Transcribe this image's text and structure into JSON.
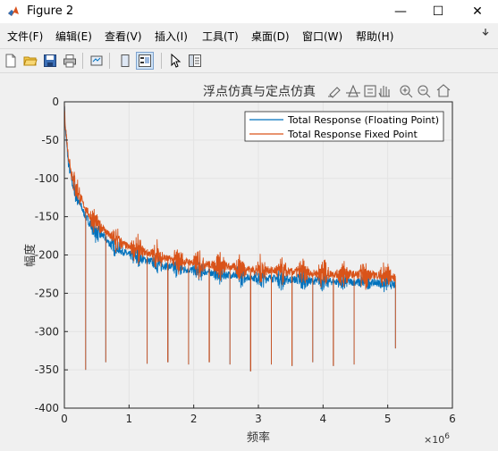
{
  "window": {
    "title": "Figure 2",
    "minimize": "—",
    "maximize": "☐",
    "close": "✕"
  },
  "menu": [
    {
      "label": "文件(F)"
    },
    {
      "label": "编辑(E)"
    },
    {
      "label": "查看(V)"
    },
    {
      "label": "插入(I)"
    },
    {
      "label": "工具(T)"
    },
    {
      "label": "桌面(D)"
    },
    {
      "label": "窗口(W)"
    },
    {
      "label": "帮助(H)"
    }
  ],
  "toolbar": {
    "icons": [
      "new-figure-icon",
      "open-file-icon",
      "save-icon",
      "print-icon",
      "link-plot-icon",
      "hide-plot-tools-icon",
      "show-plot-tools-icon",
      "edit-plot-icon",
      "open-property-inspector-icon"
    ]
  },
  "axes_toolbar": {
    "icons": [
      "brush-icon",
      "data-tips-icon",
      "rotate-icon",
      "pan-icon",
      "zoom-in-icon",
      "zoom-out-icon",
      "home-icon"
    ]
  },
  "colors": {
    "series1": "#0072BD",
    "series2": "#D95319"
  },
  "chart_data": {
    "type": "line",
    "title": "浮点仿真与定点仿真",
    "xlabel": "频率",
    "ylabel": "幅度",
    "x_exponent_label": "×10",
    "x_exponent_power": "6",
    "xlim": [
      0,
      6000000
    ],
    "ylim": [
      -400,
      0
    ],
    "xticks": [
      0,
      1,
      2,
      3,
      4,
      5,
      6
    ],
    "yticks": [
      0,
      -50,
      -100,
      -150,
      -200,
      -250,
      -300,
      -350,
      -400
    ],
    "grid": true,
    "legend_position": "top-right",
    "series": [
      {
        "name": "Total Response (Floating Point)",
        "color": "#0072BD",
        "x": [
          0,
          10000,
          60000,
          120000,
          200000,
          300000,
          400000,
          500000,
          600000,
          700000,
          800000,
          1000000,
          1200000,
          1400000,
          1600000,
          1800000,
          2000000,
          2200000,
          2400000,
          2600000,
          2800000,
          3000000,
          3200000,
          3400000,
          3600000,
          3800000,
          4000000,
          4200000,
          4400000,
          4600000,
          4800000,
          5000000,
          5120000
        ],
        "y": [
          0,
          -30,
          -80,
          -105,
          -125,
          -145,
          -160,
          -170,
          -175,
          -185,
          -190,
          -200,
          -205,
          -210,
          -215,
          -218,
          -220,
          -222,
          -225,
          -226,
          -228,
          -230,
          -230,
          -232,
          -232,
          -234,
          -234,
          -235,
          -235,
          -236,
          -236,
          -237,
          -240
        ]
      },
      {
        "name": "Total Response Fixed Point",
        "color": "#D95319",
        "x": [
          0,
          10000,
          60000,
          120000,
          200000,
          300000,
          400000,
          500000,
          600000,
          700000,
          800000,
          1000000,
          1200000,
          1400000,
          1600000,
          1800000,
          2000000,
          2200000,
          2400000,
          2600000,
          2800000,
          3000000,
          3200000,
          3400000,
          3600000,
          3800000,
          4000000,
          4200000,
          4400000,
          4600000,
          4800000,
          5000000,
          5120000
        ],
        "y": [
          0,
          -25,
          -70,
          -95,
          -115,
          -135,
          -150,
          -160,
          -165,
          -175,
          -180,
          -190,
          -195,
          -200,
          -205,
          -208,
          -210,
          -212,
          -214,
          -216,
          -218,
          -220,
          -220,
          -222,
          -222,
          -224,
          -224,
          -225,
          -225,
          -226,
          -226,
          -227,
          -230
        ]
      }
    ],
    "notch_x": [
      330000,
      640000,
      960000,
      1280000,
      1600000,
      1920000,
      2240000,
      2560000,
      2880000,
      3200000,
      3520000,
      3840000,
      4160000,
      4480000,
      4800000,
      5120000
    ],
    "notch_y": [
      -350,
      -340,
      -343,
      -342,
      -340,
      -343,
      -340,
      -343,
      -352,
      -343,
      -345,
      -340,
      -345,
      -343,
      -340,
      -322
    ]
  }
}
